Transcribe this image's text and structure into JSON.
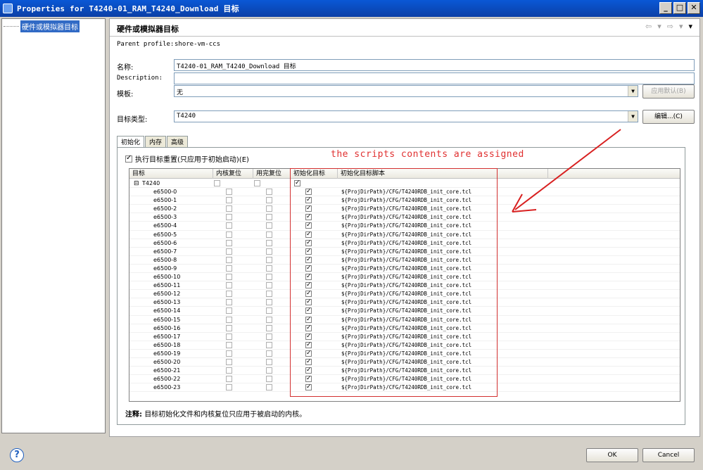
{
  "window": {
    "title": "Properties for T4240-01_RAM_T4240_Download 目标",
    "buttons": [
      "_",
      "□",
      "✕"
    ]
  },
  "tree": {
    "items": [
      {
        "label": "硬件或模拟器目标"
      }
    ]
  },
  "page": {
    "title": "硬件或模拟器目标",
    "nav": [
      "⇦",
      "▾",
      "⇨",
      "▾",
      "▾"
    ]
  },
  "form": {
    "parent_profile_label": "Parent profile:",
    "parent_profile_value": "shore-vm-ccs",
    "name_label": "名称:",
    "name_value": "T4240-01_RAM_T4240_Download 目标",
    "description_label": "Description:",
    "description_value": "",
    "template_label": "模板:",
    "template_value": "无",
    "apply_default_button": "应用默认(B)",
    "target_type_label": "目标类型:",
    "target_type_value": "T4240",
    "edit_button": "编辑...(C)"
  },
  "tabs": [
    {
      "label": "初始化",
      "active": true
    },
    {
      "label": "内存",
      "active": false
    },
    {
      "label": "高级",
      "active": false
    }
  ],
  "option": {
    "label": "执行目标重置(只应用于初始启动)(E)",
    "checked": true
  },
  "annotation": "the scripts contents are assigned",
  "table": {
    "headers": [
      "目标",
      "内核复位",
      "用完复位",
      "初始化目标",
      "初始化目标脚本"
    ],
    "root": "T4240",
    "rows": [
      {
        "name": "e6500-0",
        "script": "${ProjDirPath}/CFG/T4240RDB_init_core.tcl"
      },
      {
        "name": "e6500-1",
        "script": "${ProjDirPath}/CFG/T4240RDB_init_core.tcl"
      },
      {
        "name": "e6500-2",
        "script": "${ProjDirPath}/CFG/T4240RDB_init_core.tcl"
      },
      {
        "name": "e6500-3",
        "script": "${ProjDirPath}/CFG/T4240RDB_init_core.tcl"
      },
      {
        "name": "e6500-4",
        "script": "${ProjDirPath}/CFG/T4240RDB_init_core.tcl"
      },
      {
        "name": "e6500-5",
        "script": "${ProjDirPath}/CFG/T4240RDB_init_core.tcl"
      },
      {
        "name": "e6500-6",
        "script": "${ProjDirPath}/CFG/T4240RDB_init_core.tcl"
      },
      {
        "name": "e6500-7",
        "script": "${ProjDirPath}/CFG/T4240RDB_init_core.tcl"
      },
      {
        "name": "e6500-8",
        "script": "${ProjDirPath}/CFG/T4240RDB_init_core.tcl"
      },
      {
        "name": "e6500-9",
        "script": "${ProjDirPath}/CFG/T4240RDB_init_core.tcl"
      },
      {
        "name": "e6500-10",
        "script": "${ProjDirPath}/CFG/T4240RDB_init_core.tcl"
      },
      {
        "name": "e6500-11",
        "script": "${ProjDirPath}/CFG/T4240RDB_init_core.tcl"
      },
      {
        "name": "e6500-12",
        "script": "${ProjDirPath}/CFG/T4240RDB_init_core.tcl"
      },
      {
        "name": "e6500-13",
        "script": "${ProjDirPath}/CFG/T4240RDB_init_core.tcl"
      },
      {
        "name": "e6500-14",
        "script": "${ProjDirPath}/CFG/T4240RDB_init_core.tcl"
      },
      {
        "name": "e6500-15",
        "script": "${ProjDirPath}/CFG/T4240RDB_init_core.tcl"
      },
      {
        "name": "e6500-16",
        "script": "${ProjDirPath}/CFG/T4240RDB_init_core.tcl"
      },
      {
        "name": "e6500-17",
        "script": "${ProjDirPath}/CFG/T4240RDB_init_core.tcl"
      },
      {
        "name": "e6500-18",
        "script": "${ProjDirPath}/CFG/T4240RDB_init_core.tcl"
      },
      {
        "name": "e6500-19",
        "script": "${ProjDirPath}/CFG/T4240RDB_init_core.tcl"
      },
      {
        "name": "e6500-20",
        "script": "${ProjDirPath}/CFG/T4240RDB_init_core.tcl"
      },
      {
        "name": "e6500-21",
        "script": "${ProjDirPath}/CFG/T4240RDB_init_core.tcl"
      },
      {
        "name": "e6500-22",
        "script": "${ProjDirPath}/CFG/T4240RDB_init_core.tcl"
      },
      {
        "name": "e6500-23",
        "script": "${ProjDirPath}/CFG/T4240RDB_init_core.tcl"
      }
    ]
  },
  "note": {
    "label": "注释:",
    "text": "目标初始化文件和内核复位只应用于被启动的内核。"
  },
  "footer": {
    "help": "?",
    "ok": "OK",
    "cancel": "Cancel"
  },
  "colors": {
    "titlebar": "#0b4fc0",
    "selection": "#316ac5",
    "annotation": "#e03030",
    "redbox": "#d23030"
  }
}
